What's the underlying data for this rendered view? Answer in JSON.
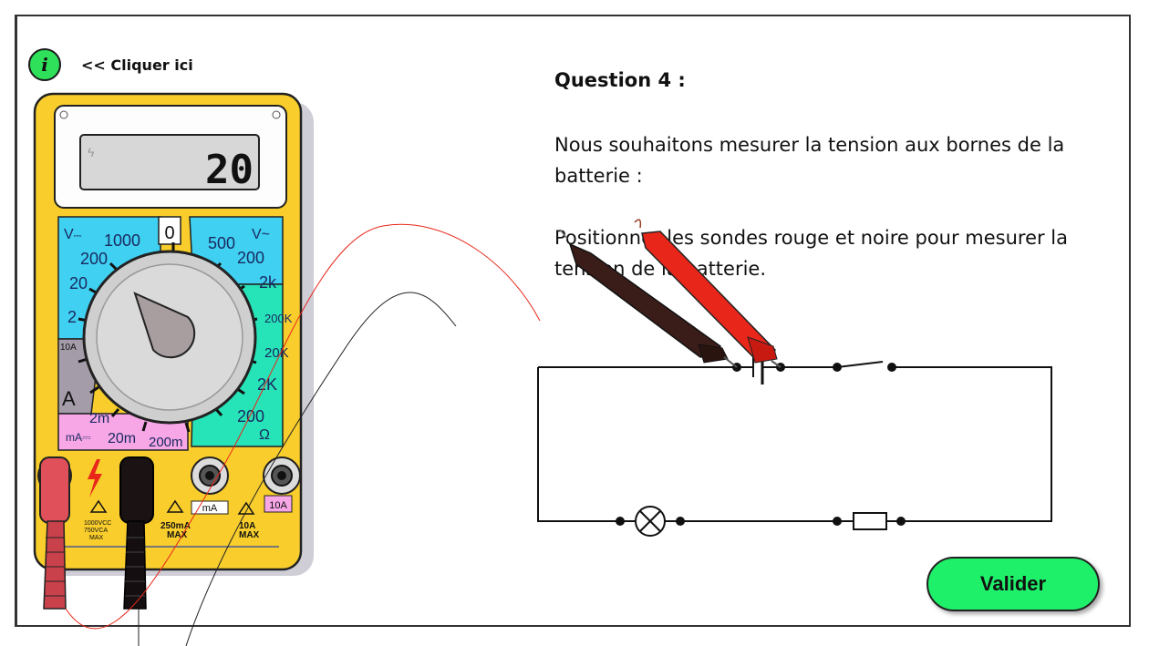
{
  "info": {
    "icon_glyph": "i",
    "hint": "<< Cliquer ici"
  },
  "question": {
    "title": "Question 4 :",
    "paragraph1": "Nous souhaitons mesurer la tension aux bornes de la batterie :",
    "paragraph2": "Positionner les sondes rouge et noire pour mesurer la tension de la batterie."
  },
  "multimeter": {
    "display_value": "20",
    "left_scale": {
      "v_label": "V",
      "r1000": "1000",
      "r200": "200",
      "r20": "20",
      "r2": "2",
      "r10a": "10A",
      "a": "A"
    },
    "right_scale": {
      "v_label": "V",
      "r500": "500",
      "r200": "200",
      "r2k": "2k",
      "r200k": "200K",
      "r20k": "20K",
      "r2K": "2K",
      "r200o": "200",
      "ohm": "Ω"
    },
    "top_zero": "0",
    "bottom_scale": {
      "r2m": "2m",
      "ma": "mA",
      "r20m": "20m",
      "r200m": "200m"
    },
    "jack_labels": {
      "ma": "mA",
      "tenA": "10A"
    },
    "warnings": {
      "w1": "1000VCC 750VCA MAX",
      "w2": "250mA MAX",
      "w3": "10A MAX"
    },
    "colors": {
      "body": "#f8cd2c",
      "cyan": "#3fd0f2",
      "teal": "#27e3b8",
      "pink": "#f7a6e6",
      "gray": "#a49ca8"
    }
  },
  "circuit": {
    "components": [
      "battery",
      "switch",
      "lamp",
      "resistor"
    ],
    "probe_colors": {
      "red": "#e8261a",
      "black": "#3a1d18"
    }
  },
  "validate": {
    "label": "Valider"
  }
}
